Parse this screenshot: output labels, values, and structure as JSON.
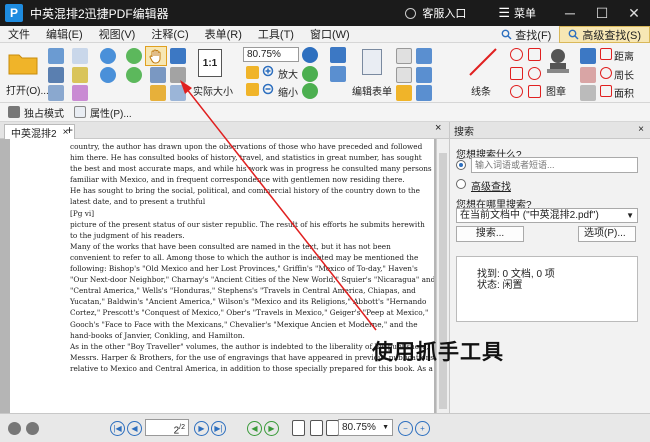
{
  "app": {
    "logo": "P",
    "title": "中英混排2迅捷PDF编辑器"
  },
  "titlebar": {
    "service": "客服入口",
    "menu_glyph": "☰",
    "menu": "菜单",
    "minimize": "─",
    "maximize": "☐",
    "close": "✕"
  },
  "menubar": {
    "items": [
      "文件",
      "编辑(E)",
      "视图(V)",
      "注释(C)",
      "表单(R)",
      "工具(T)",
      "窗口(W)"
    ],
    "find": "查找(F)",
    "advanced_find": "高级查找(S)"
  },
  "toolbar": {
    "open": "打开(O)...",
    "actual_size": "实际大小",
    "actual_size_icon": "1:1",
    "zoom_value": "80.75%",
    "zoom_in": "放大",
    "zoom_out": "缩小",
    "edit_form": "编辑表单",
    "lines": "线条",
    "stamp": "图章",
    "distance": "距离",
    "perimeter": "周长",
    "area": "面积"
  },
  "subbar": {
    "exclusive_mode": "独占模式",
    "properties": "属性(P)..."
  },
  "tab": {
    "label": "中英混排2",
    "close": "×",
    "add": "+"
  },
  "document": {
    "lines": [
      "country, the author has drawn upon the observations of those who have preceded and followed",
      "him there. He has consulted books of history, travel, and statistics in great number, has sought",
      "the best and most accurate maps, and while his work was in progress he consulted many persons",
      "familiar with Mexico, and in frequent correspondence with gentlemen now residing there.",
      "He has sought to bring the social, political, and commercial history of the country down to the",
      "latest date, and to present a truthful",
      "[Pg vi]",
      " picture of the present status of our sister republic. The result of his efforts he submits herewith",
      "to the judgment of his readers.",
      "Many of the works that have been consulted are named in the text, but it has not been",
      "convenient to refer to all. Among those to which the author is indebted may be mentioned the",
      "following: Bishop's \"Old Mexico and her Lost Provinces,\" Griffin's \"Mexico of To-day,\" Haven's",
      "\"Our Next-door Neighbor,\" Charnay's \"Ancient Cities of the New World,\" Squier's \"Nicaragua\" and",
      "\"Central America,\" Wells's \"Honduras,\" Stephens's \"Travels in Central America, Chiapas, and",
      "Yucatan,\" Baldwin's \"Ancient America,\" Wilson's \"Mexico and its Religions,\" Abbott's \"Hernando",
      "Cortez,\" Prescott's \"Conquest of Mexico,\" Ober's \"Travels in Mexico,\" Geiger's \"Peep at Mexico,\"",
      "Gooch's \"Face to Face with the Mexicans,\" Chevalier's \"Mexique Ancien et Moderne,\" and the",
      "hand-books of Janvier, Conkling, and Hamilton.",
      "As in the other \"Boy Traveller\" volumes, the author is indebted to the liberality of his publishers,",
      "Messrs. Harper & Brothers, for the use of engravings that have appeared in previous publications",
      "relative to Mexico and Central America, in addition to those specially prepared for this book. As a"
    ]
  },
  "panel": {
    "title": "搜索",
    "close": "×",
    "what_label": "您想搜索什么?",
    "search_placeholder": "输入词语或者短语...",
    "advanced": "高级查找",
    "where_label": "您想在哪里搜索?",
    "where_value": "在当前文档中 (\"中英混排2.pdf\")",
    "search_btn": "搜索...",
    "options_btn": "选项(P)...",
    "found": "找到: 0 文档, 0 项",
    "status": "状态: 闲置"
  },
  "statusbar": {
    "page_current": "2",
    "page_total": "/2",
    "zoom": "80.75%"
  },
  "annotation": {
    "text": "使用抓手工具"
  },
  "colors": {
    "titlebar": "#1b1b1b",
    "accent_blue": "#2d6fbf",
    "annotation_red": "#e02020",
    "highlight": "#f7e7b4"
  }
}
